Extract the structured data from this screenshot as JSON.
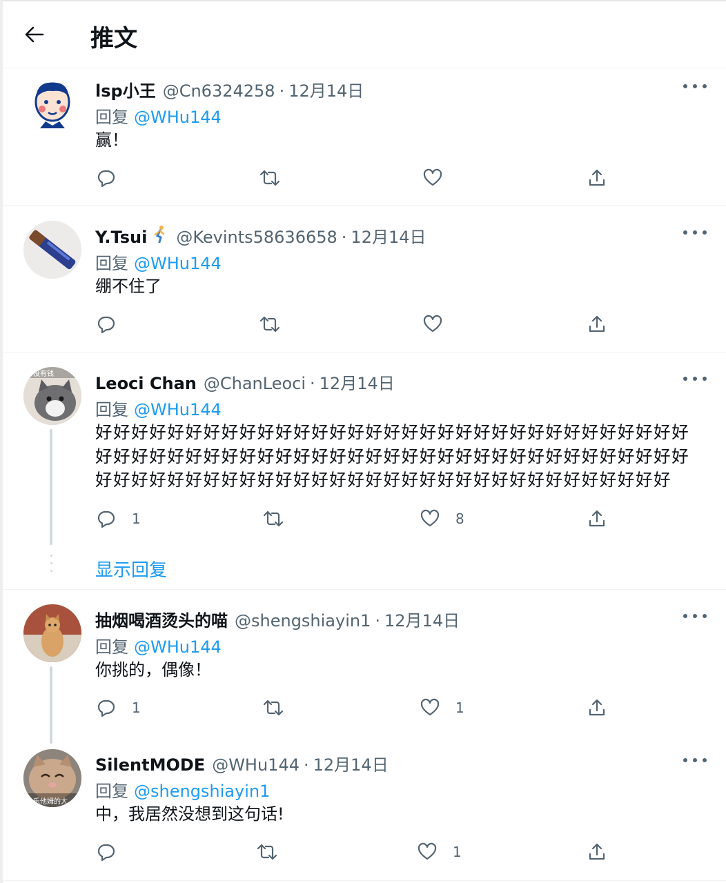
{
  "header": {
    "title": "推文",
    "back_icon": "arrow-left-icon"
  },
  "colors": {
    "link": "#1d9bf0",
    "secondary_text": "#536471",
    "primary_text": "#0f1419"
  },
  "reply_prefix": "回复",
  "tweets": [
    {
      "name": "lsp小王",
      "handle": "@Cn6324258",
      "sep": "·",
      "date": "12月14日",
      "reply_to": "@WHu144",
      "text": "赢！",
      "reply_count": "",
      "retweet_count": "",
      "like_count": ""
    },
    {
      "name": "Y.Tsui",
      "name_emoji": "person-running-emoji",
      "handle": "@Kevints58636658",
      "sep": "·",
      "date": "12月14日",
      "reply_to": "@WHu144",
      "text": "绷不住了",
      "reply_count": "",
      "retweet_count": "",
      "like_count": ""
    },
    {
      "name": "Leoci Chan",
      "handle": "@ChanLeoci",
      "sep": "·",
      "date": "12月14日",
      "reply_to": "@WHu144",
      "text": "好好好好好好好好好好好好好好好好好好好好好好好好好好好好好好好好好好好好好好好好好好好好好好好好好好好好好好好好好好好好好好好好好好好好好好好好好好好好好好好好好好好好好好好好好好好好好好好好好好",
      "reply_count": "1",
      "retweet_count": "",
      "like_count": "8",
      "avatar_text": "没有钱"
    },
    {
      "name": "抽烟喝酒烫头的喵",
      "handle": "@shengshiayin1",
      "sep": "·",
      "date": "12月14日",
      "reply_to": "@WHu144",
      "text": "你挑的，偶像！",
      "reply_count": "1",
      "retweet_count": "",
      "like_count": "1"
    },
    {
      "name": "SilentMODE",
      "handle": "@WHu144",
      "sep": "·",
      "date": "12月14日",
      "reply_to": "@shengshiayin1",
      "text": "中，我居然没想到这句话!",
      "reply_count": "",
      "retweet_count": "",
      "like_count": "1",
      "avatar_text": "乐他姆的大"
    }
  ],
  "show_replies": "显示回复",
  "action_icons": [
    "reply-icon",
    "retweet-icon",
    "like-icon",
    "share-icon"
  ]
}
